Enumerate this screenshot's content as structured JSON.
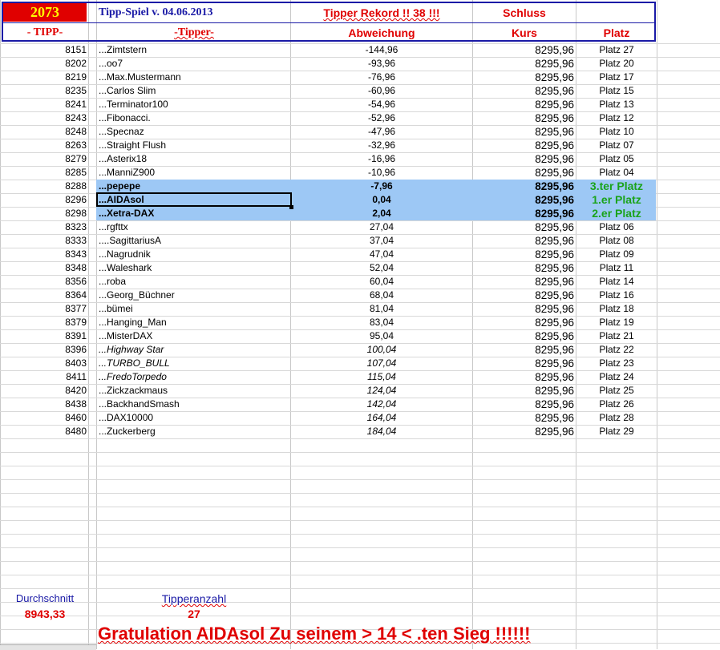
{
  "header": {
    "tipp_number": "2073",
    "game_title": "Tipp-Spiel v. 04.06.2013",
    "record_text": "Tipper Rekord !!  38  !!!",
    "close_label": "Schluss",
    "col_tipp": "- TIPP-",
    "col_tipper": "-Tipper-",
    "col_deviation": "Abweichung",
    "col_kurs": "Kurs",
    "col_platz": "Platz"
  },
  "rows": [
    {
      "tipp": "8151",
      "name": "...Zimtstern",
      "dev": "-144,96",
      "kurs": "8295,96",
      "platz": "Platz 27",
      "style": "normal"
    },
    {
      "tipp": "8202",
      "name": "...oo7",
      "dev": "-93,96",
      "kurs": "8295,96",
      "platz": "Platz 20",
      "style": "normal"
    },
    {
      "tipp": "8219",
      "name": "...Max.Mustermann",
      "dev": "-76,96",
      "kurs": "8295,96",
      "platz": "Platz 17",
      "style": "normal"
    },
    {
      "tipp": "8235",
      "name": "...Carlos Slim",
      "dev": "-60,96",
      "kurs": "8295,96",
      "platz": "Platz 15",
      "style": "normal"
    },
    {
      "tipp": "8241",
      "name": "...Terminator100",
      "dev": "-54,96",
      "kurs": "8295,96",
      "platz": "Platz 13",
      "style": "normal"
    },
    {
      "tipp": "8243",
      "name": "...Fibonacci.",
      "dev": "-52,96",
      "kurs": "8295,96",
      "platz": "Platz 12",
      "style": "normal"
    },
    {
      "tipp": "8248",
      "name": "...Specnaz",
      "dev": "-47,96",
      "kurs": "8295,96",
      "platz": "Platz 10",
      "style": "normal"
    },
    {
      "tipp": "8263",
      "name": "...Straight Flush",
      "dev": "-32,96",
      "kurs": "8295,96",
      "platz": "Platz 07",
      "style": "normal"
    },
    {
      "tipp": "8279",
      "name": "...Asterix18",
      "dev": "-16,96",
      "kurs": "8295,96",
      "platz": "Platz 05",
      "style": "normal"
    },
    {
      "tipp": "8285",
      "name": "...ManniZ900",
      "dev": "-10,96",
      "kurs": "8295,96",
      "platz": "Platz 04",
      "style": "normal"
    },
    {
      "tipp": "8288",
      "name": "...pepepe",
      "dev": "-7,96",
      "kurs": "8295,96",
      "platz": "3.ter Platz",
      "style": "highlight"
    },
    {
      "tipp": "8296",
      "name": "...AIDAsol",
      "dev": "0,04",
      "kurs": "8295,96",
      "platz": "1.er Platz",
      "style": "highlight"
    },
    {
      "tipp": "8298",
      "name": "...Xetra-DAX",
      "dev": "2,04",
      "kurs": "8295,96",
      "platz": "2.er Platz",
      "style": "highlight"
    },
    {
      "tipp": "8323",
      "name": "...rgfttx",
      "dev": "27,04",
      "kurs": "8295,96",
      "platz": "Platz 06",
      "style": "normal"
    },
    {
      "tipp": "8333",
      "name": "....SagittariusA",
      "dev": "37,04",
      "kurs": "8295,96",
      "platz": "Platz 08",
      "style": "normal"
    },
    {
      "tipp": "8343",
      "name": "...Nagrudnik",
      "dev": "47,04",
      "kurs": "8295,96",
      "platz": "Platz 09",
      "style": "normal"
    },
    {
      "tipp": "8348",
      "name": "...Waleshark",
      "dev": "52,04",
      "kurs": "8295,96",
      "platz": "Platz 11",
      "style": "normal"
    },
    {
      "tipp": "8356",
      "name": "...roba",
      "dev": "60,04",
      "kurs": "8295,96",
      "platz": "Platz 14",
      "style": "normal"
    },
    {
      "tipp": "8364",
      "name": "...Georg_Büchner",
      "dev": "68,04",
      "kurs": "8295,96",
      "platz": "Platz 16",
      "style": "normal"
    },
    {
      "tipp": "8377",
      "name": "...bümei",
      "dev": "81,04",
      "kurs": "8295,96",
      "platz": "Platz 18",
      "style": "normal"
    },
    {
      "tipp": "8379",
      "name": "...Hanging_Man",
      "dev": "83,04",
      "kurs": "8295,96",
      "platz": "Platz 19",
      "style": "normal"
    },
    {
      "tipp": "8391",
      "name": "...MisterDAX",
      "dev": "95,04",
      "kurs": "8295,96",
      "platz": "Platz 21",
      "style": "normal"
    },
    {
      "tipp": "8396",
      "name": "...Highway Star",
      "dev": "100,04",
      "kurs": "8295,96",
      "platz": "Platz 22",
      "style": "italic"
    },
    {
      "tipp": "8403",
      "name": "...TURBO_BULL",
      "dev": "107,04",
      "kurs": "8295,96",
      "platz": "Platz 23",
      "style": "italic"
    },
    {
      "tipp": "8411",
      "name": "...FredoTorpedo",
      "dev": "115,04",
      "kurs": "8295,96",
      "platz": "Platz 24",
      "style": "italic"
    },
    {
      "tipp": "8420",
      "name": "...Zickzackmaus",
      "dev": "124,04",
      "kurs": "8295,96",
      "platz": "Platz 25",
      "style": "italic-dev"
    },
    {
      "tipp": "8438",
      "name": "...BackhandSmash",
      "dev": "142,04",
      "kurs": "8295,96",
      "platz": "Platz 26",
      "style": "italic-dev"
    },
    {
      "tipp": "8460",
      "name": "...DAX10000",
      "dev": "164,04",
      "kurs": "8295,96",
      "platz": "Platz 28",
      "style": "italic-dev"
    },
    {
      "tipp": "8480",
      "name": "...Zuckerberg",
      "dev": "184,04",
      "kurs": "8295,96",
      "platz": "Platz 29",
      "style": "italic-dev"
    }
  ],
  "footer": {
    "average_label": "Durchschnitt",
    "average_value": "8943,33",
    "count_label": "Tipperanzahl",
    "count_value": "27",
    "congrats": "Gratulation AIDAsol  Zu seinem > 14 < .ten Sieg !!!!!!"
  },
  "colors": {
    "accent_red": "#e00000",
    "header_blue": "#1a1aa6",
    "highlight_blue": "#9dc8f5",
    "winner_green": "#1aa31a",
    "tipp_yellow": "#ffff00"
  }
}
